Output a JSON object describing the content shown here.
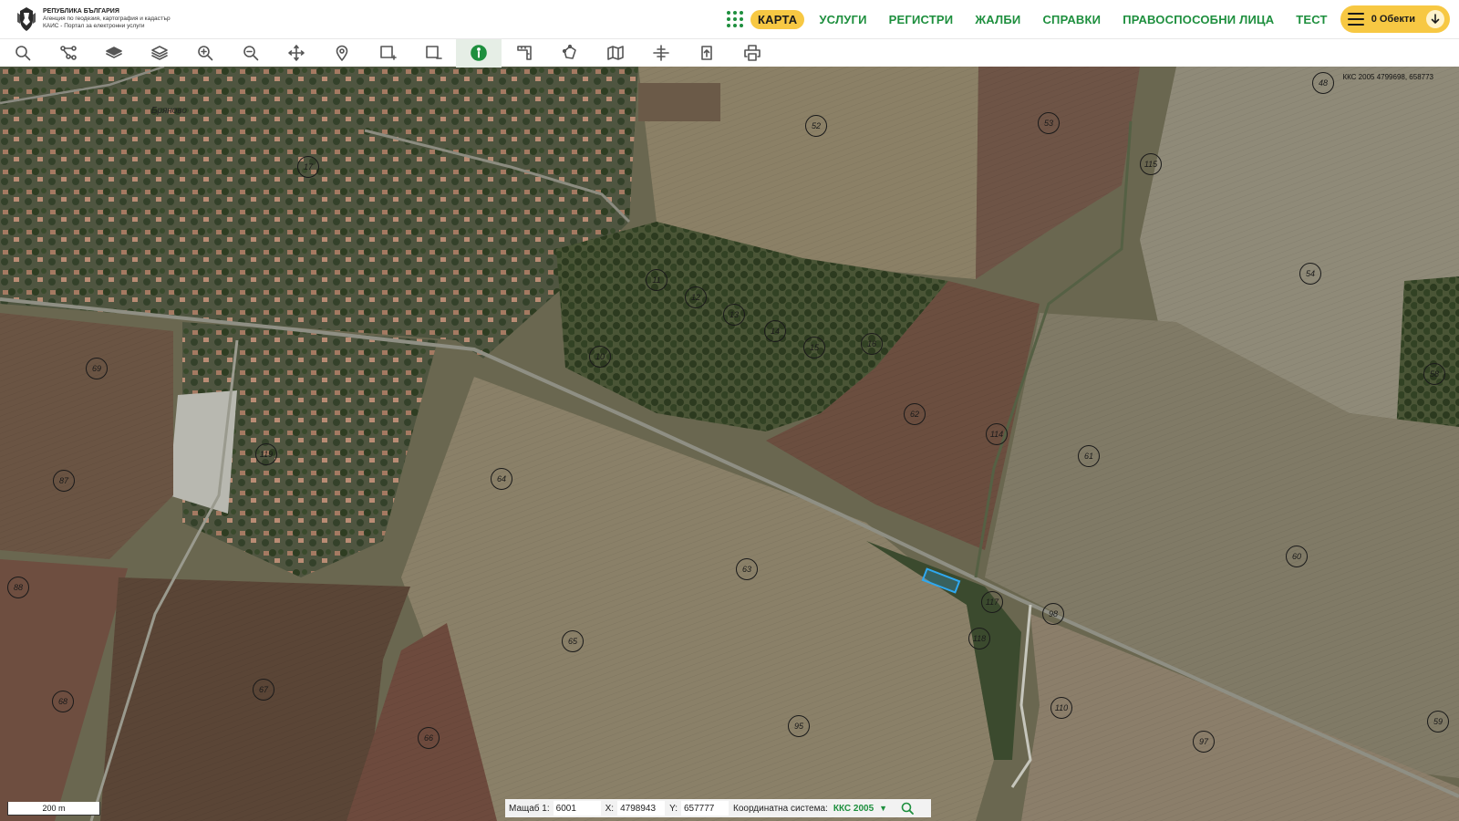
{
  "header": {
    "logo_line1": "РЕПУБЛИКА БЪЛГАРИЯ",
    "logo_line2": "Агенция по геодезия, картография и кадастър",
    "logo_line3": "КАИС - Портал за електронни услуги",
    "nav": [
      {
        "label": "КАРТА"
      },
      {
        "label": "УСЛУГИ"
      },
      {
        "label": "РЕГИСТРИ"
      },
      {
        "label": "ЖАЛБИ"
      },
      {
        "label": "СПРАВКИ"
      },
      {
        "label": "ПРАВОСПОСОБНИ ЛИЦА"
      },
      {
        "label": "ТЕСТ"
      }
    ],
    "objects_label": "0 Обекти"
  },
  "toolbar": {
    "tools": [
      {
        "name": "search-tool",
        "icon": "search-icon"
      },
      {
        "name": "route-tool",
        "icon": "nodes-icon"
      },
      {
        "name": "layers-tool",
        "icon": "layers-filled-icon"
      },
      {
        "name": "layers-manage-tool",
        "icon": "layers-icon"
      },
      {
        "name": "zoom-in-tool",
        "icon": "zoom-in-icon"
      },
      {
        "name": "zoom-out-tool",
        "icon": "zoom-out-icon"
      },
      {
        "name": "pan-tool",
        "icon": "move-icon"
      },
      {
        "name": "locate-tool",
        "icon": "pin-icon"
      },
      {
        "name": "select-add-tool",
        "icon": "rect-plus-icon"
      },
      {
        "name": "select-remove-tool",
        "icon": "rect-minus-icon"
      },
      {
        "name": "info-tool",
        "icon": "info-icon",
        "active": true
      },
      {
        "name": "measure-distance-tool",
        "icon": "ruler-icon"
      },
      {
        "name": "measure-area-tool",
        "icon": "polygon-icon"
      },
      {
        "name": "map-tool",
        "icon": "map-icon"
      },
      {
        "name": "coordinates-tool",
        "icon": "crosshair-icon"
      },
      {
        "name": "export-tool",
        "icon": "export-icon"
      },
      {
        "name": "print-tool",
        "icon": "print-icon"
      }
    ]
  },
  "map": {
    "top_coords": "ККС 2005 4799698, 658773",
    "place_label": "Бряново",
    "parcel_numbers": [
      "48",
      "52",
      "53",
      "115",
      "54",
      "17",
      "11",
      "12",
      "13",
      "14",
      "15",
      "16",
      "10",
      "62",
      "114",
      "61",
      "58",
      "69",
      "119",
      "64",
      "87",
      "63",
      "60",
      "88",
      "117",
      "98",
      "118",
      "65",
      "67",
      "68",
      "66",
      "95",
      "110",
      "97",
      "59"
    ]
  },
  "scale_bar": "200 m",
  "status": {
    "scale_label": "Мащаб 1:",
    "scale_value": "6001",
    "x_label": "X:",
    "x_value": "4798943",
    "y_label": "Y:",
    "y_value": "657777",
    "crs_label": "Координатна система:",
    "crs_value": "ККС 2005"
  },
  "colors": {
    "brand_green": "#1e8f3e",
    "accent_yellow": "#f7c843",
    "selection_blue": "#2fa8f0"
  }
}
